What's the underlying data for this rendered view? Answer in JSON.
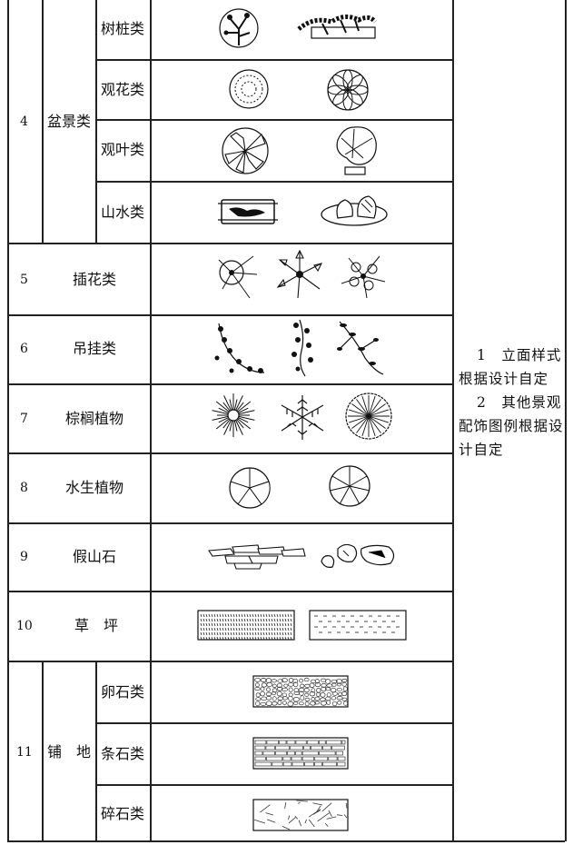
{
  "rows": {
    "r4": {
      "num": "4",
      "category": "盆景类",
      "subs": [
        "树桩类",
        "观花类",
        "观叶类",
        "山水类"
      ]
    },
    "r5": {
      "num": "5",
      "name": "插花类"
    },
    "r6": {
      "num": "6",
      "name": "吊挂类"
    },
    "r7": {
      "num": "7",
      "name": "棕榈植物"
    },
    "r8": {
      "num": "8",
      "name": "水生植物"
    },
    "r9": {
      "num": "9",
      "name": "假山石"
    },
    "r10": {
      "num": "10",
      "name": "草　坪"
    },
    "r11": {
      "num": "11",
      "category": "铺　地",
      "subs": [
        "卵石类",
        "条石类",
        "碎石类"
      ]
    }
  },
  "notes": {
    "n1": "1　立面样式根据设计自定",
    "n2": "2　其他景观配饰图例根据设计自定"
  }
}
